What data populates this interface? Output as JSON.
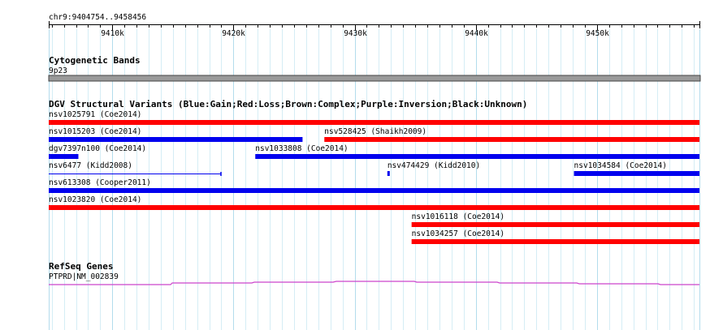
{
  "region": "chr9:9404754..9458456",
  "ruler": {
    "start": 9404754,
    "end": 9458456,
    "ticks": [
      {
        "pos": 9410000,
        "label": "9410k"
      },
      {
        "pos": 9420000,
        "label": "9420k"
      },
      {
        "pos": 9430000,
        "label": "9430k"
      },
      {
        "pos": 9440000,
        "label": "9440k"
      },
      {
        "pos": 9450000,
        "label": "9450k"
      }
    ],
    "minor_step": 1000
  },
  "tracks": {
    "cytoband": {
      "title": "Cytogenetic Bands",
      "band_label": "9p23",
      "band_color": "#9a9a9a"
    },
    "dgv": {
      "title": "DGV Structural Variants (Blue:Gain;Red:Loss;Brown:Complex;Purple:Inversion;Black:Unknown)",
      "colors": {
        "gain": "#0000ee",
        "loss": "#ff0000"
      },
      "features": [
        {
          "label": "nsv1025791 (Coe2014)",
          "start": 9404754,
          "end": 9458456,
          "type": "loss",
          "row": 0
        },
        {
          "label": "nsv1015203 (Coe2014)",
          "start": 9404754,
          "end": 9425700,
          "type": "gain",
          "row": 1
        },
        {
          "label": "nsv528425 (Shaikh2009)",
          "start": 9427500,
          "end": 9458456,
          "type": "loss",
          "row": 1
        },
        {
          "label": "dgv7397n100 (Coe2014)",
          "start": 9404754,
          "end": 9407200,
          "type": "gain",
          "row": 2
        },
        {
          "label": "nsv1033808 (Coe2014)",
          "start": 9421800,
          "end": 9458456,
          "type": "gain",
          "row": 2
        },
        {
          "label": "nsv6477 (Kidd2008)",
          "start": 9404754,
          "end": 9419000,
          "type": "gain",
          "style": "thin",
          "row": 3
        },
        {
          "label": "nsv474429 (Kidd2010)",
          "start": 9432700,
          "end": 9432900,
          "type": "gain",
          "row": 3
        },
        {
          "label": "nsv1034584 (Coe2014)",
          "start": 9448100,
          "end": 9458456,
          "type": "gain",
          "row": 3
        },
        {
          "label": "nsv613308 (Cooper2011)",
          "start": 9404754,
          "end": 9458456,
          "type": "gain",
          "row": 4
        },
        {
          "label": "nsv1023820 (Coe2014)",
          "start": 9404754,
          "end": 9458456,
          "type": "loss",
          "row": 5
        },
        {
          "label": "nsv1016118 (Coe2014)",
          "start": 9434700,
          "end": 9458456,
          "type": "loss",
          "row": 6
        },
        {
          "label": "nsv1034257 (Coe2014)",
          "start": 9434700,
          "end": 9458456,
          "type": "loss",
          "row": 7
        }
      ]
    },
    "refseq": {
      "title": "RefSeq Genes",
      "gene_label": "PTPRD|NM_002839",
      "color": "#cc44cc"
    }
  }
}
